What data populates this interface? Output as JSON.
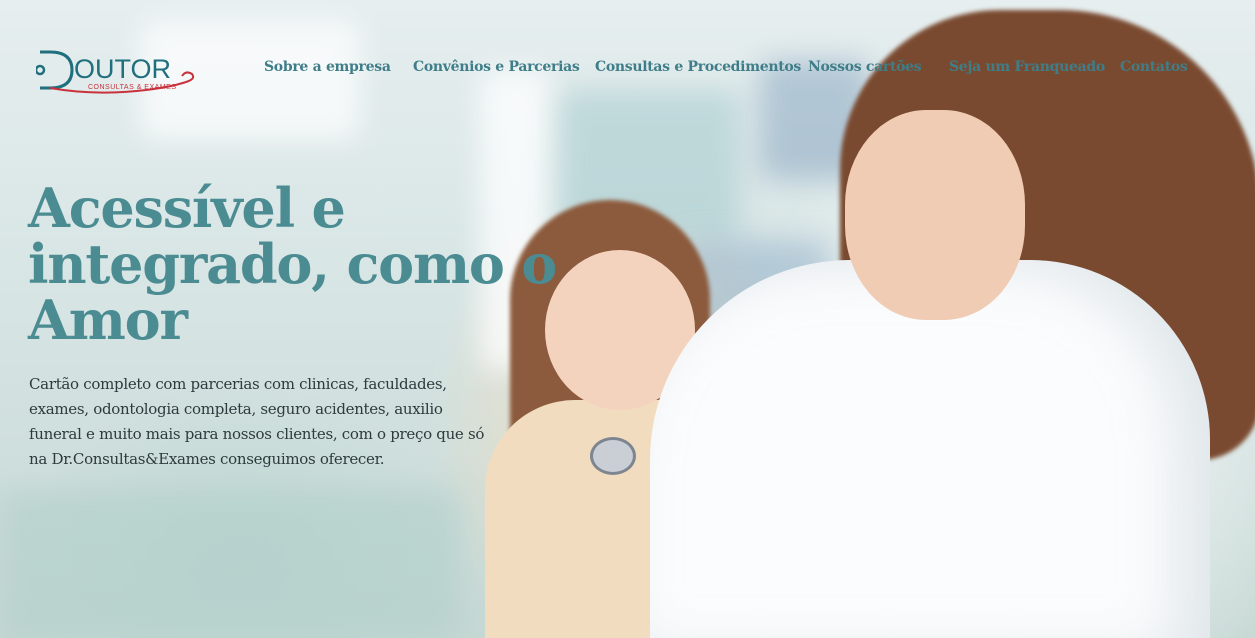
{
  "brand": {
    "name": "OUTOR",
    "tagline": "CONSULTAS & EXAMES",
    "colors": {
      "teal": "#1f6f7c",
      "red": "#c8323c"
    }
  },
  "nav": {
    "items": [
      {
        "label": "Sobre a empresa"
      },
      {
        "label": "Convênios e Parcerias"
      },
      {
        "label": "Consultas e Procedimentos"
      },
      {
        "label": "Nossos cartões"
      },
      {
        "label": "Seja um Franqueado"
      },
      {
        "label": "Contatos"
      }
    ],
    "color": "#3f7d88"
  },
  "hero": {
    "headline_lines": [
      "Acessível e",
      "integrado, como o",
      "Amor"
    ],
    "lead_lines": [
      "Cartão completo com parcerias com clinicas, faculdades,",
      "exames, odontologia completa, seguro acidentes, auxilio",
      "funeral e muito mais para nossos clientes, com o preço que só",
      "na Dr.Consultas&Exames conseguimos oferecer."
    ],
    "headline_color": "#4b8c93"
  },
  "photo": {
    "description_icon": "doctor-examining-child-photo"
  }
}
